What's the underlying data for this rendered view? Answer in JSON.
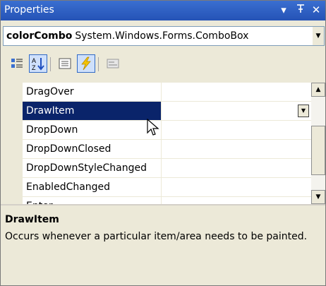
{
  "window": {
    "title": "Properties"
  },
  "titlebar": {
    "pin_glyph": "−$",
    "dropdown_glyph": "▾",
    "pin": "1",
    "close": "×"
  },
  "object_selector": {
    "name": "colorCombo",
    "type": "System.Windows.Forms.ComboBox"
  },
  "toolbar": {
    "buttons": [
      "categorized",
      "alphabetical",
      "properties",
      "events",
      "property-pages"
    ],
    "active": [
      "alphabetical",
      "events"
    ]
  },
  "grid": {
    "rows": [
      {
        "name": "DragOver",
        "value": ""
      },
      {
        "name": "DrawItem",
        "value": ""
      },
      {
        "name": "DropDown",
        "value": ""
      },
      {
        "name": "DropDownClosed",
        "value": ""
      },
      {
        "name": "DropDownStyleChanged",
        "value": ""
      },
      {
        "name": "EnabledChanged",
        "value": ""
      },
      {
        "name": "Enter",
        "value": ""
      }
    ],
    "selected_index": 1
  },
  "description": {
    "title": "DrawItem",
    "text": "Occurs whenever a particular item/area needs to be painted."
  },
  "colors": {
    "title_bar": "#2a5bc0",
    "selection": "#0a246a",
    "panel": "#ece9d8"
  }
}
